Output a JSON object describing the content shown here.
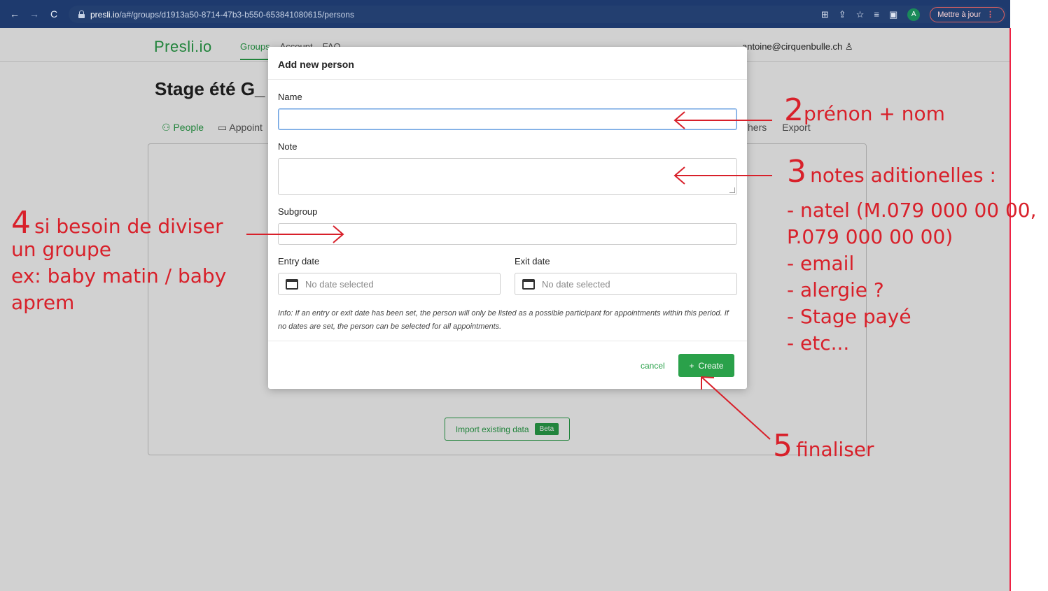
{
  "browser": {
    "url_host": "presli.io",
    "url_path": "/a#/groups/d1913a50-8714-47b3-b550-653841080615/persons",
    "avatar_letter": "A",
    "update_label": "Mettre à jour"
  },
  "app": {
    "logo": "Presli.io",
    "nav": [
      "Groups",
      "Account",
      "FAQ"
    ],
    "user_email": "antoine@cirquenbulle.ch",
    "page_title": "Stage été G_",
    "subnav": [
      "People",
      "Appoint"
    ],
    "subnav_right": [
      "hers",
      "Export"
    ],
    "import_label": "Import existing data",
    "beta_label": "Beta"
  },
  "modal": {
    "title": "Add new person",
    "name_label": "Name",
    "note_label": "Note",
    "subgroup_label": "Subgroup",
    "entry_label": "Entry date",
    "exit_label": "Exit date",
    "entry_placeholder": "No date selected",
    "exit_placeholder": "No date selected",
    "info": "Info: If an entry or exit date has been set, the person will only be listed as a possible participant for appointments within this period. If no dates are set, the person can be selected for all appointments.",
    "cancel_label": "cancel",
    "create_label": "Create"
  },
  "annotations": {
    "a2_num": "2",
    "a2_text": "prénon + nom",
    "a3_num": "3",
    "a3_text": "notes aditionelles :",
    "a3_lines": [
      "- natel (M.079 000 00 00,",
      "P.079 000 00 00)",
      "- email",
      "- alergie ?",
      "- Stage payé",
      "- etc..."
    ],
    "a4_num": "4",
    "a4_text": "si besoin de diviser",
    "a4_lines": [
      "un groupe",
      "ex: baby matin / baby",
      "aprem"
    ],
    "a5_num": "5",
    "a5_text": "finaliser"
  },
  "colors": {
    "brand_green": "#2aa14a",
    "annotation_red": "#d8202a",
    "chrome_blue": "#1e3a6e"
  }
}
